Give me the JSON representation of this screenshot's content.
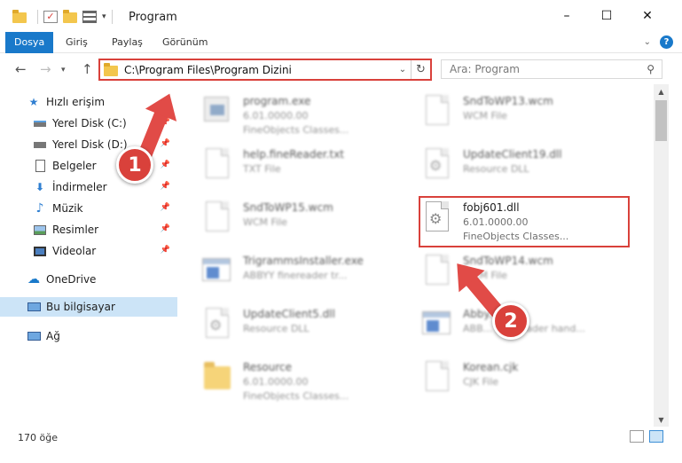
{
  "window": {
    "title": "Program",
    "controls": {
      "minimize": "–",
      "maximize": "☐",
      "close": "✕"
    }
  },
  "ribbon": {
    "tabs": [
      {
        "label": "Dosya",
        "active": true
      },
      {
        "label": "Giriş"
      },
      {
        "label": "Paylaş"
      },
      {
        "label": "Görünüm"
      }
    ]
  },
  "address": {
    "path": "C:\\Program Files\\Program Dizini",
    "search_placeholder": "Ara: Program"
  },
  "sidebar": {
    "items": [
      {
        "label": "Hızlı erişim",
        "icon": "star-icon"
      },
      {
        "label": "Yerel Disk (C:)",
        "icon": "drive-icon",
        "pinned": true
      },
      {
        "label": "Yerel Disk (D:)",
        "icon": "drive-icon",
        "pinned": true
      },
      {
        "label": "Belgeler",
        "icon": "documents-icon",
        "pinned": true
      },
      {
        "label": "İndirmeler",
        "icon": "download-icon",
        "pinned": true
      },
      {
        "label": "Müzik",
        "icon": "music-icon",
        "pinned": true
      },
      {
        "label": "Resimler",
        "icon": "pictures-icon",
        "pinned": true
      },
      {
        "label": "Videolar",
        "icon": "video-icon",
        "pinned": true
      },
      {
        "label": "OneDrive",
        "icon": "cloud-icon"
      },
      {
        "label": "Bu bilgisayar",
        "icon": "computer-icon",
        "selected": true
      },
      {
        "label": "Ağ",
        "icon": "network-icon"
      }
    ]
  },
  "files": [
    {
      "name": "program.exe",
      "line2": "6.01.0000.00",
      "line3": "FineObjects Classes...",
      "icon": "exe-icon"
    },
    {
      "name": "SndToWP13.wcm",
      "line2": "WCM File",
      "icon": "file-icon"
    },
    {
      "name": "help.fineReader.txt",
      "line2": "TXT File",
      "icon": "file-icon"
    },
    {
      "name": "UpdateClient19.dll",
      "line2": "Resource DLL",
      "icon": "dll-icon"
    },
    {
      "name": "SndToWP15.wcm",
      "line2": "WCM File",
      "icon": "file-icon"
    },
    {
      "name": "fobj601.dll",
      "line2": "6.01.0000.00",
      "line3": "FineObjects Classes...",
      "icon": "dll-icon",
      "highlighted": true
    },
    {
      "name": "TrigrammsInstaller.exe",
      "line2": "ABBYY finereader tr...",
      "icon": "app-icon"
    },
    {
      "name": "SndToWP14.wcm",
      "line2": "WCM File",
      "icon": "file-icon"
    },
    {
      "name": "UpdateClient5.dll",
      "line2": "Resource DLL",
      "icon": "dll-icon"
    },
    {
      "name": "Abby...exe",
      "line2": "ABB... fineReader hand...",
      "icon": "app-icon"
    },
    {
      "name": "Resource",
      "line2": "6.01.0000.00",
      "line3": "FineObjects Classes...",
      "icon": "folder-icon"
    },
    {
      "name": "Korean.cjk",
      "line2": "CJK File",
      "icon": "file-icon"
    }
  ],
  "status": {
    "count": "170 öğe"
  },
  "callouts": {
    "step1": "1",
    "step2": "2"
  },
  "colors": {
    "accent": "#1979ca",
    "callout": "#d9413b",
    "selected": "#cce4f7"
  }
}
